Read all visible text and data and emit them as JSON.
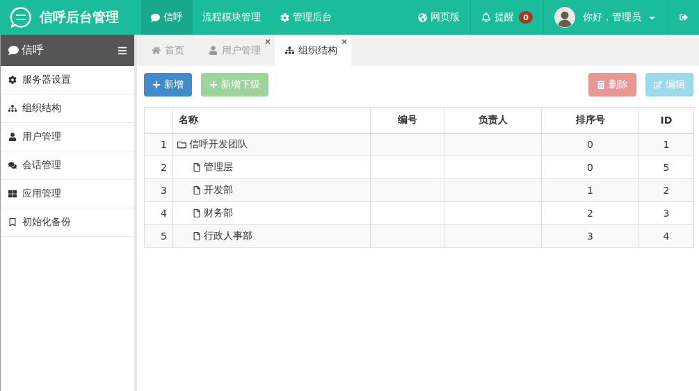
{
  "header": {
    "title": "信呼后台管理",
    "nav": [
      {
        "label": "信呼",
        "selected": true
      },
      {
        "label": "流程模块管理",
        "selected": false
      },
      {
        "label": "管理后台",
        "selected": false
      }
    ],
    "web_version": "网页版",
    "reminder": {
      "label": "提醒",
      "count": "0"
    },
    "user": {
      "greeting": "你好，管理员"
    }
  },
  "sidebar": {
    "title": "信呼",
    "items": [
      "服务器设置",
      "组织结构",
      "用户管理",
      "会话管理",
      "应用管理",
      "初始化备份"
    ]
  },
  "tabs": [
    {
      "label": "首页",
      "selected": false,
      "closable": false
    },
    {
      "label": "用户管理",
      "selected": false,
      "closable": true
    },
    {
      "label": "组织结构",
      "selected": true,
      "closable": true
    }
  ],
  "toolbar": {
    "left_buttons": [
      {
        "label": "新增",
        "kind": "primary",
        "disabled": false
      },
      {
        "label": "新增下级",
        "kind": "success",
        "disabled": true
      }
    ],
    "right_buttons": [
      {
        "label": "删除",
        "kind": "danger",
        "disabled": true
      },
      {
        "label": "编辑",
        "kind": "info",
        "disabled": true
      }
    ]
  },
  "table": {
    "columns": [
      "名称",
      "编号",
      "负责人",
      "排序号",
      "ID"
    ],
    "rows": [
      {
        "number": "1",
        "name": "信呼开发团队",
        "sort_order": "0",
        "id": "1",
        "children": [
          {
            "number": "2",
            "name": "管理层",
            "sort_order": "0",
            "id": "5"
          },
          {
            "number": "3",
            "name": "开发部",
            "sort_order": "1",
            "id": "2"
          },
          {
            "number": "4",
            "name": "财务部",
            "sort_order": "2",
            "id": "3"
          },
          {
            "number": "5",
            "name": "行政人事部",
            "sort_order": "3",
            "id": "4"
          }
        ]
      }
    ]
  }
}
